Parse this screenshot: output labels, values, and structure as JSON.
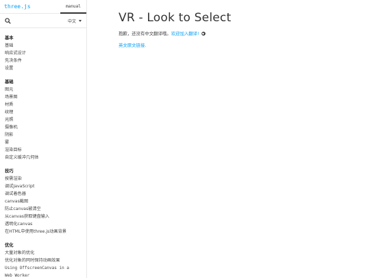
{
  "sidebar": {
    "brand": "three.js",
    "tab": "manual",
    "language": "中文",
    "groups": [
      {
        "title": "基本",
        "items": [
          "基础",
          "响应式设计",
          "先决条件",
          "设置"
        ]
      },
      {
        "title": "基础",
        "items": [
          "图元",
          "场景图",
          "材质",
          "纹理",
          "光照",
          "摄像机",
          "阴影",
          "雾",
          "渲染目标",
          "自定义缓冲几何体"
        ]
      },
      {
        "title": "技巧",
        "items": [
          "按需渲染",
          "调试JavaScript",
          "调试着色器",
          "canvas截图",
          "防止canvas被清空",
          "从canvas获取键盘输入",
          "透明化canvas",
          "在HTML中使用three.js动画背景"
        ]
      },
      {
        "title": "优化",
        "items": [
          "大量对象的优化",
          "优化对象的同时保持动画效果",
          "Using OffscreenCanvas in a",
          "Web Worker"
        ]
      }
    ]
  },
  "main": {
    "title": "VR - Look to Select",
    "notice_text": "抱歉，还没有中文翻译哦。",
    "notice_link": "欢迎加入翻译!",
    "original_link": "英文原文链接."
  },
  "colors": {
    "accent": "#049ef4",
    "text": "#444444",
    "title": "#333333"
  }
}
